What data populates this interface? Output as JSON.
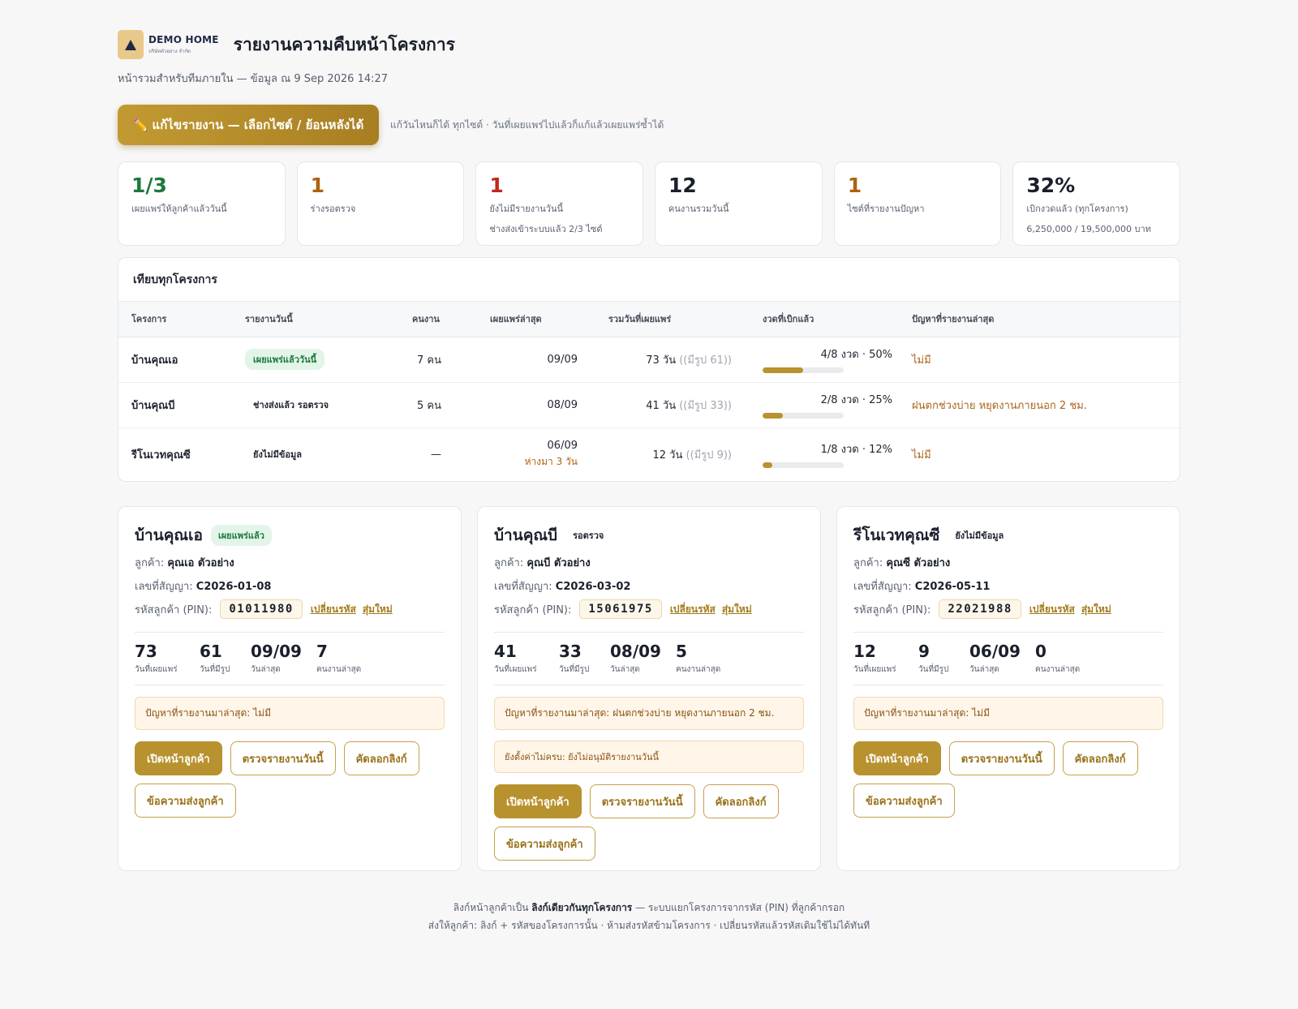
{
  "header": {
    "brand_name": "DEMO HOME",
    "brand_sub": "บริษัทตัวอย่าง จำกัด",
    "title": "รายงานความคืบหน้าโครงการ",
    "subtitle": "หน้ารวมสำหรับทีมภายใน — ข้อมูล ณ 9 Sep 2026 14:27"
  },
  "edit": {
    "button_label": "✏️ แก้ไขรายงาน — เลือกไซต์ / ย้อนหลังได้",
    "hint": "แก้วันไหนก็ได้ ทุกไซต์ · วันที่เผยแพร่ไปแล้วก็แก้แล้วเผยแพร่ซ้ำได้"
  },
  "stats": [
    {
      "value": "1/3",
      "label": "เผยแพร่ให้ลูกค้าแล้ววันนี้",
      "sub": "",
      "color": "#1b7a3c"
    },
    {
      "value": "1",
      "label": "ร่างรอตรวจ",
      "sub": "",
      "color": "#b06010"
    },
    {
      "value": "1",
      "label": "ยังไม่มีรายงานวันนี้",
      "sub": "ช่างส่งเข้าระบบแล้ว 2/3 ไซต์",
      "color": "#c0281d"
    },
    {
      "value": "12",
      "label": "คนงานรวมวันนี้",
      "sub": "",
      "color": "#1a1f2b"
    },
    {
      "value": "1",
      "label": "ไซต์ที่รายงานปัญหา",
      "sub": "",
      "color": "#b06010"
    },
    {
      "value": "32%",
      "label": "เบิกงวดแล้ว (ทุกโครงการ)",
      "sub": "6,250,000 / 19,500,000 บาท",
      "color": "#1a1f2b"
    }
  ],
  "compare": {
    "title": "เทียบทุกโครงการ",
    "columns": [
      "โครงการ",
      "รายงานวันนี้",
      "คนงาน",
      "เผยแพร่ล่าสุด",
      "รวมวันที่เผยแพร่",
      "งวดที่เบิกแล้ว",
      "ปัญหาที่รายงานล่าสุด"
    ],
    "rows": [
      {
        "name": "บ้านคุณเอ",
        "status": "เผยแพร่แล้ววันนี้",
        "workers": "7 คน",
        "last": "09/09",
        "late": "",
        "days": "73 วัน",
        "photo": "((มีรูป 61))",
        "progress_text": "4/8 งวด · 50%",
        "progress": 0.5,
        "issue": "ไม่มี"
      },
      {
        "name": "บ้านคุณบี",
        "status": "ช่างส่งแล้ว รอตรวจ",
        "workers": "5 คน",
        "last": "08/09",
        "late": "",
        "days": "41 วัน",
        "photo": "((มีรูป 33))",
        "progress_text": "2/8 งวด · 25%",
        "progress": 0.25,
        "issue": "ฝนตกช่วงบ่าย หยุดงานภายนอก 2 ชม."
      },
      {
        "name": "รีโนเวทคุณซี",
        "status": "ยังไม่มีข้อมูล",
        "workers": "—",
        "last": "06/09",
        "late": "ห่างมา 3 วัน",
        "days": "12 วัน",
        "photo": "((มีรูป 9))",
        "progress_text": "1/8 งวด · 12%",
        "progress": 0.12,
        "issue": "ไม่มี"
      }
    ]
  },
  "labels": {
    "customer": "ลูกค้า:",
    "contract": "เลขที่สัญญา:",
    "pin": "รหัสลูกค้า (PIN):",
    "change_pin": "เปลี่ยนรหัส",
    "random_pin": "สุ่มใหม่",
    "days_published": "วันที่เผยแพร่",
    "days_photo": "วันที่มีรูป",
    "last_day": "วันล่าสุด",
    "last_workers": "คนงานล่าสุด",
    "btn_open": "เปิดหน้าลูกค้า",
    "btn_review": "ตรวจรายงานวันนี้",
    "btn_copy": "คัดลอกลิงก์",
    "btn_message": "ข้อความส่งลูกค้า"
  },
  "cards": [
    {
      "title": "บ้านคุณเอ",
      "badge": "เผยแพร่แล้ว",
      "badge_style": "green",
      "customer": "คุณเอ ตัวอย่าง",
      "contract": "C2026-01-08",
      "pin": "01011980",
      "days": "73",
      "photo_days": "61",
      "last_day": "09/09",
      "workers": "7",
      "issue": "ปัญหาที่รายงานมาล่าสุด: ไม่มี",
      "warning": ""
    },
    {
      "title": "บ้านคุณบี",
      "badge": "รอตรวจ",
      "badge_style": "plain",
      "customer": "คุณบี ตัวอย่าง",
      "contract": "C2026-03-02",
      "pin": "15061975",
      "days": "41",
      "photo_days": "33",
      "last_day": "08/09",
      "workers": "5",
      "issue": "ปัญหาที่รายงานมาล่าสุด: ฝนตกช่วงบ่าย หยุดงานภายนอก 2 ชม.",
      "warning": "ยังตั้งค่าไม่ครบ: ยังไม่อนุมัติรายงานวันนี้"
    },
    {
      "title": "รีโนเวทคุณซี",
      "badge": "ยังไม่มีข้อมูล",
      "badge_style": "plain",
      "customer": "คุณซี ตัวอย่าง",
      "contract": "C2026-05-11",
      "pin": "22021988",
      "days": "12",
      "photo_days": "9",
      "last_day": "06/09",
      "workers": "0",
      "issue": "ปัญหาที่รายงานมาล่าสุด: ไม่มี",
      "warning": ""
    }
  ],
  "footer": {
    "line1_pre": "ลิงก์หน้าลูกค้าเป็น ",
    "line1_bold": "ลิงก์เดียวกันทุกโครงการ",
    "line1_post": " — ระบบแยกโครงการจากรหัส (PIN) ที่ลูกค้ากรอก",
    "line2": "ส่งให้ลูกค้า: ลิงก์ + รหัสของโครงการนั้น · ห้ามส่งรหัสข้ามโครงการ · เปลี่ยนรหัสแล้วรหัสเดิมใช้ไม่ได้ทันที"
  },
  "colors": {
    "accent": "#b8922e",
    "success": "#1b7a3c",
    "warning": "#b06010",
    "danger": "#c0281d"
  }
}
